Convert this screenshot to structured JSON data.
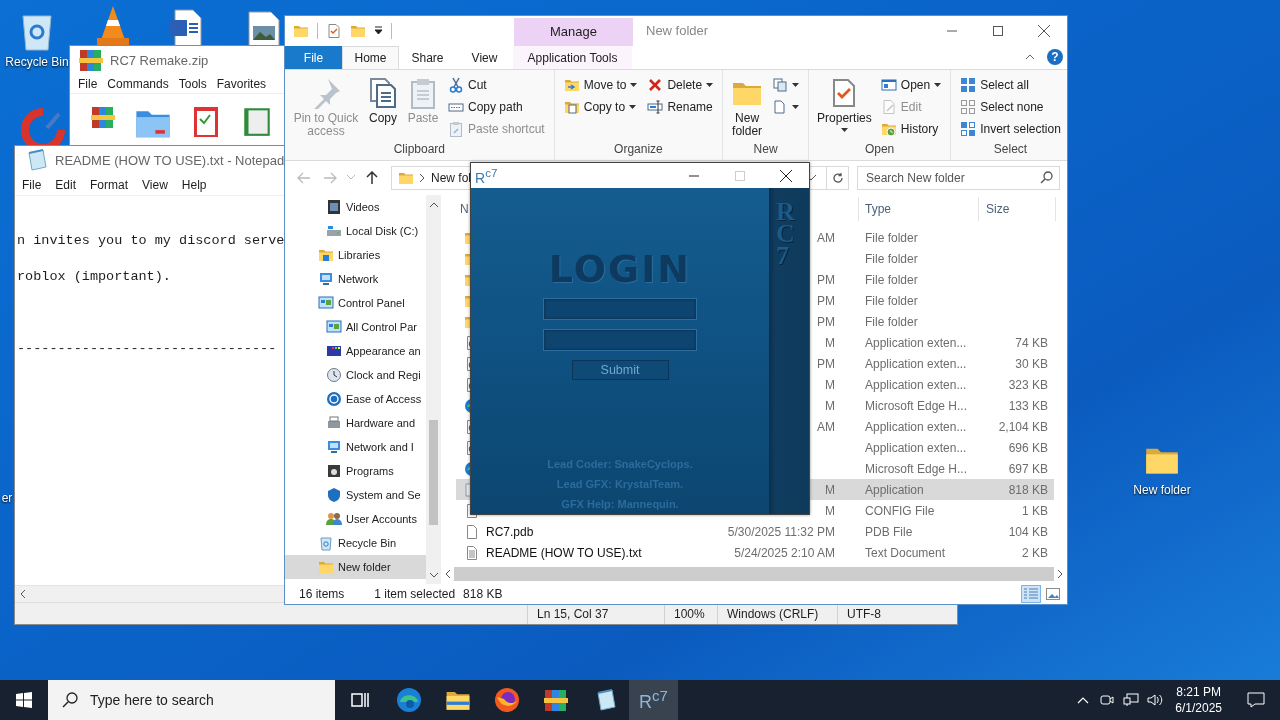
{
  "desktop": {
    "icons": [
      {
        "kind": "bin",
        "label": "Recycle Bin"
      },
      {
        "kind": "cone"
      },
      {
        "kind": "document"
      },
      {
        "kind": "image"
      },
      {
        "kind": "disc"
      },
      {
        "kind": "label",
        "label": "er"
      },
      {
        "kind": "folder",
        "label": "New folder"
      }
    ]
  },
  "archive_window": {
    "title": "RC7 Remake.zip",
    "menu": [
      "File",
      "Commands",
      "Tools",
      "Favorites"
    ]
  },
  "notepad": {
    "title": "README (HOW TO USE).txt - Notepad",
    "menu": [
      "File",
      "Edit",
      "Format",
      "View",
      "Help"
    ],
    "lines": [
      "n invites you to my discord serve",
      "roblox (important).",
      "--------------------------------"
    ],
    "status": [
      "Ln 15, Col 37",
      "100%",
      "Windows (CRLF)",
      "UTF-8"
    ]
  },
  "explorer": {
    "title": "New folder",
    "context_tab": "Manage",
    "tabs": [
      {
        "label": "File",
        "kind": "file",
        "selected": false
      },
      {
        "label": "Home",
        "kind": "tab",
        "selected": true
      },
      {
        "label": "Share",
        "kind": "tab",
        "selected": false
      },
      {
        "label": "View",
        "kind": "tab",
        "selected": false
      },
      {
        "label": "Application Tools",
        "kind": "context",
        "selected": false
      }
    ],
    "ribbon": [
      {
        "title": "Clipboard",
        "columns": [
          [
            {
              "kind": "large",
              "label": "Pin to Quick access",
              "disabled": true,
              "dropdown": false
            }
          ],
          [
            {
              "kind": "large",
              "label": "Copy",
              "disabled": false,
              "dropdown": false
            }
          ],
          [
            {
              "kind": "large",
              "label": "Paste",
              "disabled": true,
              "dropdown": false
            }
          ],
          [
            {
              "kind": "small",
              "label": "Cut",
              "disabled": false,
              "dropdown": false
            },
            {
              "kind": "small",
              "label": "Copy path",
              "disabled": false,
              "dropdown": false
            },
            {
              "kind": "small",
              "label": "Paste shortcut",
              "disabled": true,
              "dropdown": false
            }
          ]
        ]
      },
      {
        "title": "Organize",
        "columns": [
          [
            {
              "kind": "small",
              "label": "Move to",
              "disabled": false,
              "dropdown": true
            },
            {
              "kind": "small",
              "label": "Copy to",
              "disabled": false,
              "dropdown": true
            }
          ],
          [
            {
              "kind": "small",
              "label": "Delete",
              "disabled": false,
              "dropdown": true
            },
            {
              "kind": "small",
              "label": "Rename",
              "disabled": false,
              "dropdown": false
            }
          ]
        ]
      },
      {
        "title": "New",
        "columns": [
          [
            {
              "kind": "large",
              "label": "New folder",
              "disabled": false,
              "dropdown": false
            }
          ],
          [
            {
              "kind": "icon",
              "disabled": false,
              "dropdown": true
            },
            {
              "kind": "icon",
              "disabled": false,
              "dropdown": true
            }
          ]
        ]
      },
      {
        "title": "Open",
        "columns": [
          [
            {
              "kind": "large",
              "label": "Properties",
              "disabled": false,
              "dropdown": true
            }
          ],
          [
            {
              "kind": "small",
              "label": "Open",
              "disabled": false,
              "dropdown": true
            },
            {
              "kind": "small",
              "label": "Edit",
              "disabled": true,
              "dropdown": false
            },
            {
              "kind": "small",
              "label": "History",
              "disabled": false,
              "dropdown": false
            }
          ]
        ]
      },
      {
        "title": "Select",
        "columns": [
          [
            {
              "kind": "small",
              "label": "Select all",
              "disabled": false,
              "dropdown": false
            },
            {
              "kind": "small",
              "label": "Select none",
              "disabled": false,
              "dropdown": false
            },
            {
              "kind": "small",
              "label": "Invert selection",
              "disabled": false,
              "dropdown": false
            }
          ]
        ]
      }
    ],
    "help": "?",
    "address": "New fol",
    "search_placeholder": "Search New folder",
    "nav": [
      {
        "children": [
          {
            "kind": "video",
            "label": "Videos",
            "selected": false
          },
          {
            "kind": "disk",
            "label": "Local Disk (C:)",
            "selected": false
          }
        ]
      },
      {
        "kind": "library",
        "label": "Libraries",
        "selected": false
      },
      {
        "kind": "network",
        "label": "Network",
        "selected": false
      },
      {
        "kind": "control",
        "label": "Control Panel",
        "selected": false,
        "children": [
          {
            "kind": "control",
            "label": "All Control Par",
            "selected": false
          },
          {
            "kind": "appearance",
            "label": "Appearance an",
            "selected": false
          },
          {
            "kind": "clock",
            "label": "Clock and Regi",
            "selected": false
          },
          {
            "kind": "ease",
            "label": "Ease of Access",
            "selected": false
          },
          {
            "kind": "hardware",
            "label": "Hardware and",
            "selected": false
          },
          {
            "kind": "network",
            "label": "Network and I",
            "selected": false
          },
          {
            "kind": "programs",
            "label": "Programs",
            "selected": false
          },
          {
            "kind": "system",
            "label": "System and Se",
            "selected": false
          },
          {
            "kind": "users",
            "label": "User Accounts",
            "selected": false
          }
        ]
      },
      {
        "kind": "bin",
        "label": "Recycle Bin",
        "selected": false
      },
      {
        "kind": "folder",
        "label": "New folder",
        "selected": true
      }
    ],
    "columns": [
      "N",
      "Type",
      "Size"
    ],
    "rows": [
      {
        "kind": "folder",
        "date": "AM",
        "type": "File folder",
        "selected": false
      },
      {
        "kind": "folder",
        "type": "File folder",
        "selected": false
      },
      {
        "kind": "folder",
        "date": "PM",
        "type": "File folder",
        "selected": false
      },
      {
        "kind": "folder",
        "date": "PM",
        "type": "File folder",
        "selected": false
      },
      {
        "kind": "folder",
        "date": "PM",
        "type": "File folder",
        "selected": false
      },
      {
        "kind": "extension",
        "date": "M",
        "type": "Application exten...",
        "size": "74 KB",
        "selected": false
      },
      {
        "kind": "extension",
        "date": "PM",
        "type": "Application exten...",
        "size": "30 KB",
        "selected": false
      },
      {
        "kind": "extension",
        "date": "M",
        "type": "Application exten...",
        "size": "323 KB",
        "selected": false
      },
      {
        "kind": "browser",
        "date": "M",
        "type": "Microsoft Edge H...",
        "size": "133 KB",
        "selected": false
      },
      {
        "kind": "extension",
        "date": "AM",
        "type": "Application exten...",
        "size": "2,104 KB",
        "selected": false
      },
      {
        "kind": "extension",
        "type": "Application exten...",
        "size": "696 KB",
        "selected": false
      },
      {
        "kind": "browser",
        "type": "Microsoft Edge H...",
        "size": "697 KB",
        "selected": false
      },
      {
        "kind": "application",
        "date": "M",
        "type": "Application",
        "size": "818 KB",
        "selected": true
      },
      {
        "kind": "file",
        "date": "M",
        "type": "CONFIG File",
        "size": "1 KB",
        "selected": false
      },
      {
        "kind": "file",
        "name": "RC7.pdb",
        "date": "5/30/2025 11:32 PM",
        "type": "PDB File",
        "size": "104 KB",
        "selected": false
      },
      {
        "kind": "text",
        "name": "README (HOW TO USE).txt",
        "date": "5/24/2025 2:10 AM",
        "type": "Text Document",
        "size": "2 KB",
        "selected": false
      }
    ],
    "status": [
      "16 items",
      "1 item selected",
      "818 KB"
    ]
  },
  "login": {
    "logo": "R$^{c7}$",
    "side_text": "RC7",
    "heading": "LOGIN",
    "fields": [
      {
        "kind": "text"
      },
      {
        "kind": "text"
      }
    ],
    "button": "Submit",
    "credits": [
      "Lead Coder: SnakeCyclops.",
      "Lead GFX: KrystalTeam.",
      "GFX Help: Mannequin."
    ]
  },
  "taskbar": {
    "search_placeholder": "Type here to search",
    "apps": [
      {
        "kind": "taskview",
        "selected": false
      },
      {
        "kind": "browser",
        "selected": false
      },
      {
        "kind": "folder",
        "selected": false
      },
      {
        "kind": "fox",
        "selected": false
      },
      {
        "kind": "archive",
        "selected": false
      },
      {
        "kind": "notepad",
        "selected": false
      },
      {
        "kind": "label",
        "label": "R$^{c7}$",
        "selected": true
      }
    ],
    "time": "8:21 PM",
    "date": "6/1/2025"
  }
}
